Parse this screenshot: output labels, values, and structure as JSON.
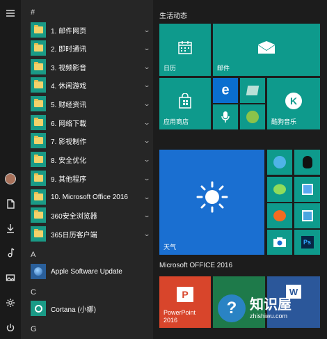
{
  "rail": {
    "items": [
      {
        "name": "hamburger-menu-icon"
      },
      {
        "name": "user-avatar"
      },
      {
        "name": "documents-icon"
      },
      {
        "name": "downloads-icon"
      },
      {
        "name": "music-icon"
      },
      {
        "name": "pictures-icon"
      },
      {
        "name": "settings-gear-icon"
      },
      {
        "name": "power-icon"
      }
    ]
  },
  "applist": {
    "headers": {
      "hash": "#",
      "a": "A",
      "c": "C",
      "g": "G"
    },
    "folders": [
      "1. 邮件网页",
      "2. 即时通讯",
      "3. 视频影音",
      "4. 休闲游戏",
      "5. 财经资讯",
      "6. 网络下载",
      "7. 影视制作",
      "8. 安全优化",
      "9. 其他程序",
      "10. Microsoft Office 2016",
      "360安全浏览器",
      "365日历客户端"
    ],
    "apple": "Apple Software Update",
    "cortana": "Cortana (小娜)"
  },
  "tiles": {
    "group1": "生活动态",
    "group2": "Microsoft OFFICE 2016",
    "calendar": "日历",
    "mail": "邮件",
    "store": "应用商店",
    "kugou": "酷狗音乐",
    "weather": "天气",
    "powerpoint": "PowerPoint\n2016",
    "kugou_letter": "K"
  },
  "watermark": {
    "text": "知识屋",
    "url": "zhishiwu.com"
  },
  "colors": {
    "accent": "#0e9a8c",
    "folder": "#f3d26a",
    "weather": "#1a6fd1",
    "office": "#d8452b"
  }
}
